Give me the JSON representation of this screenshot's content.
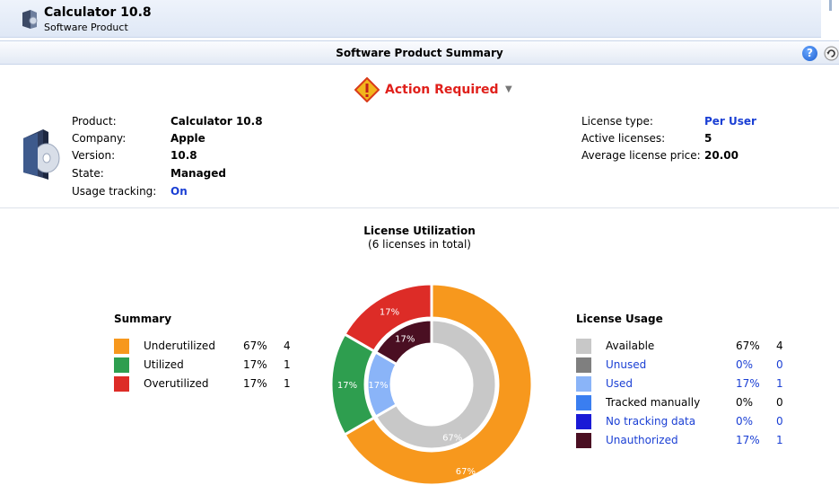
{
  "window": {
    "title": "Calculator 10.8",
    "subtitle": "Software Product",
    "icon": "software-product-icon"
  },
  "header": {
    "title": "Software Product Summary",
    "help_icon": "help-icon",
    "refresh_icon": "refresh-icon"
  },
  "status": {
    "label": "Action Required",
    "icon": "warning-icon",
    "color": "#e0201b"
  },
  "product": {
    "icon": "software-box-icon",
    "fields": [
      {
        "label": "Product:",
        "value": "Calculator 10.8"
      },
      {
        "label": "Company:",
        "value": "Apple"
      },
      {
        "label": "Version:",
        "value": "10.8"
      },
      {
        "label": "State:",
        "value": "Managed"
      },
      {
        "label": "Usage tracking:",
        "value": "On"
      }
    ]
  },
  "license": {
    "fields": [
      {
        "label": "License type:",
        "value": "Per User"
      },
      {
        "label": "Active licenses:",
        "value": "5"
      },
      {
        "label": "Average license price:",
        "value": "20.00"
      }
    ]
  },
  "utilization": {
    "title": "License Utilization",
    "subtitle": "(6 licenses in total)"
  },
  "summary_legend": {
    "title": "Summary",
    "items": [
      {
        "label": "Underutilized",
        "pct": "67%",
        "count": "4",
        "color": "#f7981d"
      },
      {
        "label": "Utilized",
        "pct": "17%",
        "count": "1",
        "color": "#2e9e4f"
      },
      {
        "label": "Overutilized",
        "pct": "17%",
        "count": "1",
        "color": "#dd2c27"
      }
    ]
  },
  "usage_legend": {
    "title": "License Usage",
    "items": [
      {
        "label": "Available",
        "pct": "67%",
        "count": "4",
        "color": "#c8c8c8",
        "link": false
      },
      {
        "label": "Unused",
        "pct": "0%",
        "count": "0",
        "color": "#7f7f7f",
        "link": true
      },
      {
        "label": "Used",
        "pct": "17%",
        "count": "1",
        "color": "#8ab4f8",
        "link": true
      },
      {
        "label": "Tracked manually",
        "pct": "0%",
        "count": "0",
        "color": "#3a7ef0",
        "link": false
      },
      {
        "label": "No tracking data",
        "pct": "0%",
        "count": "0",
        "color": "#1a1ad6",
        "link": true
      },
      {
        "label": "Unauthorized",
        "pct": "17%",
        "count": "1",
        "color": "#4a0f22",
        "link": true
      }
    ]
  },
  "chart_data": {
    "type": "pie",
    "title": "License Utilization",
    "subtitle": "(6 licenses in total)",
    "rings": [
      {
        "name": "Summary",
        "slices": [
          {
            "label": "Underutilized",
            "value": 4,
            "pct": "67%",
            "color": "#f7981d"
          },
          {
            "label": "Utilized",
            "value": 1,
            "pct": "17%",
            "color": "#2e9e4f"
          },
          {
            "label": "Overutilized",
            "value": 1,
            "pct": "17%",
            "color": "#dd2c27"
          }
        ]
      },
      {
        "name": "License Usage",
        "slices": [
          {
            "label": "Available",
            "value": 4,
            "pct": "67%",
            "color": "#c8c8c8"
          },
          {
            "label": "Used",
            "value": 1,
            "pct": "17%",
            "color": "#8ab4f8"
          },
          {
            "label": "Unauthorized",
            "value": 1,
            "pct": "17%",
            "color": "#4a0f22"
          }
        ]
      }
    ]
  }
}
